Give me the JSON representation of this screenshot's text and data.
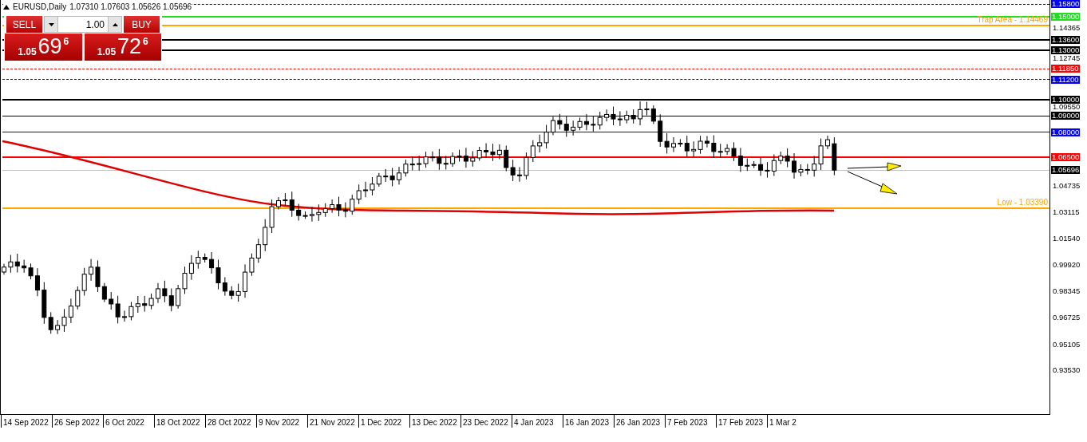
{
  "header": {
    "symbol": "EURUSD,Daily",
    "quote": "1.07310 1.07603 1.05626 1.05696"
  },
  "trade_panel": {
    "sell": {
      "label": "SELL",
      "price_head": "1.05",
      "price_main": "69",
      "price_tail": "6"
    },
    "volume": "1.00",
    "buy": {
      "label": "BUY",
      "price_head": "1.05",
      "price_main": "72",
      "price_tail": "6"
    }
  },
  "levels": [
    {
      "kind": "dashed",
      "color": "#0000ff",
      "label": "1.15800"
    },
    {
      "kind": "thick",
      "color": "#22dd22",
      "label": "1.15000"
    },
    {
      "kind": "thick",
      "color": "#000000",
      "label": "1.13600"
    },
    {
      "kind": "thick",
      "color": "#000000",
      "label": "1.13000"
    },
    {
      "kind": "dashed",
      "color": "#ff0000",
      "label": "1.11850"
    },
    {
      "kind": "dashed",
      "color": "#0000ff",
      "label": "1.11200"
    },
    {
      "kind": "thick",
      "color": "#000000",
      "label": "1.10000"
    },
    {
      "kind": "solid",
      "color": "#000000",
      "label": "1.09000"
    },
    {
      "kind": "solid",
      "color": "#0000ff",
      "label": "1.08000"
    },
    {
      "kind": "thick",
      "color": "#ff0000",
      "label": "1.06500"
    },
    {
      "kind": "bid",
      "color": "#000000",
      "label": "1.05696"
    }
  ],
  "captioned_levels": [
    {
      "kind": "thick",
      "color": "#ffa500",
      "label": "Trap Area - 1.14469"
    },
    {
      "kind": "thick",
      "color": "#ffa500",
      "label": "Low - 1.03390"
    }
  ],
  "price_axis": {
    "ticks": [
      "1.14365",
      "1.12745",
      "1.09550",
      "1.04735",
      "1.03115",
      "1.01540",
      "0.99920",
      "0.98345",
      "0.96725",
      "0.95105",
      "0.93530"
    ]
  },
  "time_axis": {
    "labels": [
      "14 Sep 2022",
      "26 Sep 2022",
      "6 Oct 2022",
      "18 Oct 2022",
      "28 Oct 2022",
      "9 Nov 2022",
      "21 Nov 2022",
      "1 Dec 2022",
      "13 Dec 2022",
      "23 Dec 2022",
      "4 Jan 2023",
      "16 Jan 2023",
      "26 Jan 2023",
      "7 Feb 2023",
      "17 Feb 2023",
      "1 Mar 2"
    ]
  }
}
